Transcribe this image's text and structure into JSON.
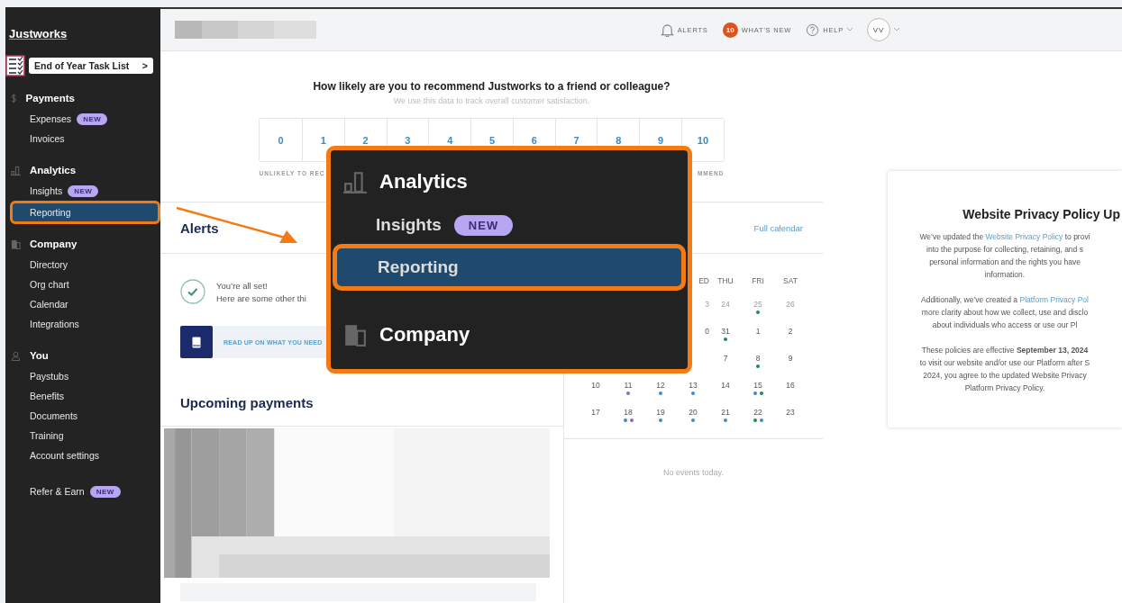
{
  "sidebar": {
    "logo": "Justworks",
    "task_button": {
      "label": "End of Year Task List",
      "chevron": ">"
    },
    "sections": [
      {
        "title": "Payments",
        "items": [
          {
            "label": "Expenses",
            "badge": "NEW",
            "selected": false
          },
          {
            "label": "Invoices",
            "selected": false
          }
        ]
      },
      {
        "title": "Analytics",
        "items": [
          {
            "label": "Insights",
            "badge": "NEW",
            "selected": false
          },
          {
            "label": "Reporting",
            "selected": true
          }
        ]
      },
      {
        "title": "Company",
        "items": [
          {
            "label": "Directory",
            "selected": false
          },
          {
            "label": "Org chart",
            "selected": false
          },
          {
            "label": "Calendar",
            "selected": false
          },
          {
            "label": "Integrations",
            "selected": false
          }
        ]
      },
      {
        "title": "You",
        "items": [
          {
            "label": "Paystubs",
            "selected": false
          },
          {
            "label": "Benefits",
            "selected": false
          },
          {
            "label": "Documents",
            "selected": false
          },
          {
            "label": "Training",
            "selected": false
          },
          {
            "label": "Account settings",
            "selected": false
          }
        ]
      }
    ],
    "extra_item": {
      "label": "Refer & Earn",
      "badge": "NEW",
      "selected": false
    }
  },
  "header": {
    "alerts": "ALERTS",
    "whats_new_count": "10",
    "whats_new": "WHAT'S NEW",
    "help": "HELP",
    "avatar": "VV"
  },
  "survey": {
    "question": "How likely are you to recommend Justworks to a friend or colleague?",
    "subtitle": "We use this data to track overall customer satisfaction.",
    "scores": [
      "0",
      "1",
      "2",
      "3",
      "4",
      "5",
      "6",
      "7",
      "8",
      "9",
      "10"
    ],
    "low_label": "UNLIKELY TO REC",
    "high_label": "MMEND"
  },
  "alerts": {
    "title": "Alerts",
    "status_title": "You’re all set!",
    "status_text": "Here are some other thi",
    "resource_link": "READ UP ON WHAT YOU NEED"
  },
  "payments": {
    "title": "Upcoming payments"
  },
  "calendar": {
    "link": "Full calendar",
    "weekdays": [
      "ED",
      "THU",
      "FRI",
      "SAT"
    ],
    "weeks": [
      {
        "days": [
          {
            "label": "3",
            "muted": true
          },
          {
            "label": "24",
            "muted": true
          },
          {
            "label": "25",
            "muted": true,
            "dots": [
              {
                "color": "#1e8a5e"
              }
            ]
          },
          {
            "label": "26",
            "muted": true
          }
        ]
      },
      {
        "days": [
          {
            "label": "0",
            "muted": false
          },
          {
            "label": "31",
            "muted": false,
            "dots": [
              {
                "color": "#1e8a5e"
              }
            ]
          },
          {
            "label": "1",
            "muted": false
          },
          {
            "label": "2",
            "muted": false
          }
        ]
      },
      {
        "days": [
          {
            "label": "7",
            "muted": false
          },
          {
            "label": "8",
            "muted": false,
            "dots": [
              {
                "color": "#1e8a5e"
              }
            ]
          },
          {
            "label": "9",
            "muted": false
          }
        ]
      },
      {
        "days": [
          {
            "label": "10",
            "muted": false
          },
          {
            "label": "11",
            "muted": false,
            "dots": [
              {
                "color": "#8a6bc4"
              }
            ]
          },
          {
            "label": "12",
            "muted": false,
            "dots": [
              {
                "color": "#3a8cc4"
              }
            ]
          },
          {
            "label": "13",
            "muted": false,
            "dots": [
              {
                "color": "#3a8cc4"
              }
            ]
          },
          {
            "label": "14",
            "muted": false
          },
          {
            "label": "15",
            "muted": false,
            "dots": [
              {
                "color": "#3a8cc4"
              },
              {
                "color": "#1e8a5e"
              }
            ]
          },
          {
            "label": "16",
            "muted": false
          }
        ]
      },
      {
        "days": [
          {
            "label": "17",
            "muted": false
          },
          {
            "label": "18",
            "muted": false,
            "dots": [
              {
                "color": "#3a8cc4"
              },
              {
                "color": "#8a6bc4"
              }
            ]
          },
          {
            "label": "19",
            "muted": false,
            "dots": [
              {
                "color": "#3a8cc4"
              }
            ]
          },
          {
            "label": "20",
            "muted": false,
            "dots": [
              {
                "color": "#3a8cc4"
              }
            ]
          },
          {
            "label": "21",
            "muted": false,
            "dots": [
              {
                "color": "#3a8cc4"
              }
            ]
          },
          {
            "label": "22",
            "muted": false,
            "dots": [
              {
                "color": "#1e8a5e"
              },
              {
                "color": "#3a8cc4"
              }
            ]
          },
          {
            "label": "23",
            "muted": false
          }
        ]
      }
    ],
    "empty": "No events today."
  },
  "policy": {
    "title": "Website Privacy Policy Up",
    "paragraphs": [
      [
        [
          {
            "kind": "text",
            "text": "We’ve updated the "
          },
          {
            "kind": "link",
            "text": "Website Privacy Policy"
          },
          {
            "kind": "text",
            "text": " to provi"
          }
        ],
        [
          {
            "kind": "text",
            "text": "into the purpose for collecting, retaining, and s"
          }
        ],
        [
          {
            "kind": "text",
            "text": "personal information and the rights you have"
          }
        ],
        [
          {
            "kind": "text",
            "text": "information."
          }
        ]
      ],
      [
        [
          {
            "kind": "text",
            "text": "Additionally, we’ve created a "
          },
          {
            "kind": "link",
            "text": "Platform Privacy Pol"
          }
        ],
        [
          {
            "kind": "text",
            "text": "more clarity about how we collect, use and disclo"
          }
        ],
        [
          {
            "kind": "text",
            "text": "about individuals who access or use our Pl"
          }
        ]
      ],
      [
        [
          {
            "kind": "text",
            "text": "These policies are effective **September 13, 2024**"
          }
        ],
        [
          {
            "kind": "text",
            "text": "to visit our website and/or use our Platform after S"
          }
        ],
        [
          {
            "kind": "text",
            "text": "2024, you agree to the updated Website Privacy"
          }
        ],
        [
          {
            "kind": "text",
            "text": "Platform Privacy Policy."
          }
        ]
      ]
    ]
  },
  "magnifier": {
    "entries": [
      {
        "kind": "section",
        "label": "Analytics"
      },
      {
        "kind": "item",
        "label": "Insights",
        "badge": "NEW",
        "selected": false
      },
      {
        "kind": "item",
        "label": "Reporting",
        "selected": true
      },
      {
        "kind": "section",
        "label": "Company"
      }
    ]
  }
}
